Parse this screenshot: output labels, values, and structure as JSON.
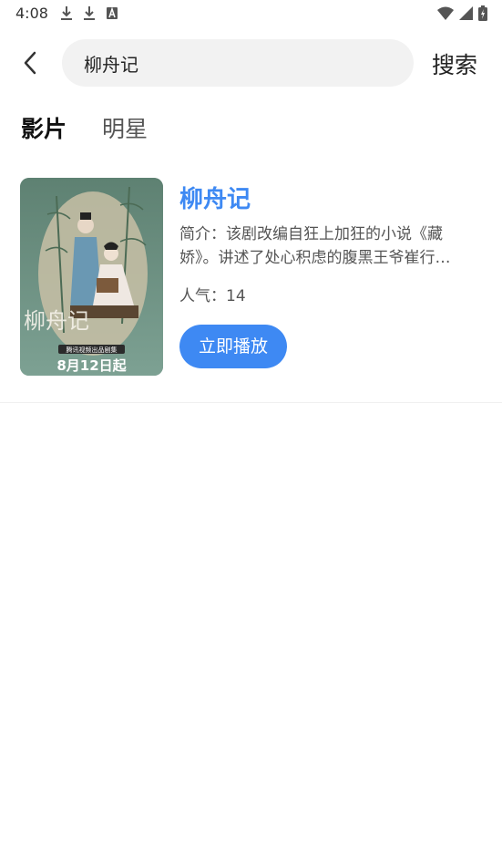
{
  "status_bar": {
    "time": "4:08",
    "icons_left": [
      "download-icon",
      "download-icon",
      "font-a-icon"
    ],
    "icons_right": [
      "wifi-icon",
      "signal-icon",
      "battery-charging-icon"
    ]
  },
  "header": {
    "back_icon": "chevron-left-icon",
    "search_value": "柳舟记",
    "search_button_label": "搜索"
  },
  "tabs": [
    {
      "label": "影片",
      "active": true
    },
    {
      "label": "明星",
      "active": false
    }
  ],
  "results": [
    {
      "title": "柳舟记",
      "description": "简介：该剧改编自狂上加狂的小说《藏娇》。讲述了处心积虑的腹黑王爷崔行…",
      "popularity": "人气：14",
      "play_label": "立即播放",
      "poster": {
        "calligraphy": "柳舟记",
        "platform_text": "腾讯视频出品剧集",
        "date_text": "8月12日起"
      }
    }
  ],
  "colors": {
    "accent": "#3e89f3",
    "search_bg": "#f2f2f2",
    "poster_bg": "#6f8f82"
  }
}
